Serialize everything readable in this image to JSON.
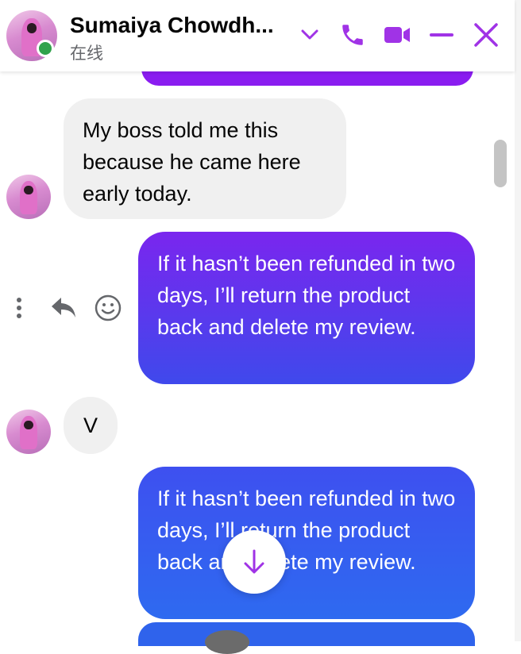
{
  "header": {
    "contact_name": "Sumaiya Chowdh...",
    "status": "在线",
    "icons": [
      "chevron-down-icon",
      "phone-icon",
      "video-icon",
      "minimize-icon",
      "close-icon"
    ],
    "accent_color": "#a033e6"
  },
  "messages": [
    {
      "side": "incoming",
      "text": "My boss told me this because he came here early today."
    },
    {
      "side": "outgoing",
      "text": "If it hasn’t been refunded in two days, I’ll return the product back and delete my review."
    },
    {
      "side": "incoming",
      "text": "V"
    },
    {
      "side": "outgoing",
      "text": "If it hasn’t been refunded in two days, I’ll return the product back and delete my review."
    }
  ],
  "message_actions": [
    "more-icon",
    "reply-icon",
    "emoji-icon"
  ],
  "colors": {
    "outgoing_purple": "#7a26ee",
    "outgoing_blue": "#2e6af0",
    "incoming_gray": "#f0f0f0",
    "online_green": "#31a24c"
  }
}
